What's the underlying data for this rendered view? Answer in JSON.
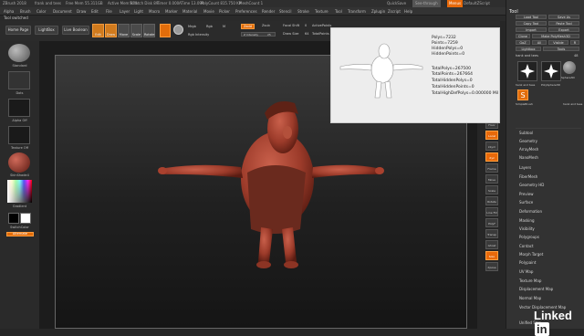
{
  "titlebar": {
    "app": "ZBrush 2018",
    "doc": "frank and tees",
    "free_mem": "Free Mem 55.311GB",
    "active_mem": "Active Mem 979",
    "scratch_disk": "Scratch Disk 89",
    "timer": "Timer 0.000",
    "atime": "ATime 13.099",
    "polycount": "PolyCount 815.750 KP",
    "mesh_count": "MeshCount 1",
    "quicksave": "QuickSave",
    "see_through": "See-through",
    "menus": "Menus",
    "default_zscript": "DefaultZScript"
  },
  "menubar": {
    "items": [
      "Alpha",
      "Brush",
      "Color",
      "Document",
      "Draw",
      "Edit",
      "File",
      "Layer",
      "Light",
      "Macro",
      "Marker",
      "Material",
      "Movie",
      "Picker",
      "Preferences",
      "Render",
      "Stencil",
      "Stroke",
      "Texture",
      "Tool",
      "Transform",
      "Zplugin",
      "Zscript",
      "Help"
    ]
  },
  "tabstrip": {
    "label": "Tool switched"
  },
  "topshelf": {
    "home_page": "Home Page",
    "lightbox": "LightBox",
    "live_boolean": "Live Boolean",
    "tools": [
      {
        "label": "Edit",
        "active": true
      },
      {
        "label": "Draw",
        "active": true
      },
      {
        "label": "Move",
        "active": false
      },
      {
        "label": "Scale",
        "active": false
      },
      {
        "label": "Rotate",
        "active": false
      }
    ],
    "mrgb": "Mrgb",
    "rgb": "Rgb",
    "m": "M",
    "rgb_intensity": "Rgb Intensity",
    "zadd": "Zadd",
    "zsub": "Zsub",
    "z_intensity": "Z Intensity",
    "z_intensity_value": "25",
    "focal_shift": "Focal Shift",
    "focal_value": "0",
    "draw_size": "Draw Size",
    "draw_size_value": "64",
    "dynamic": "Dynamic",
    "active_points": "ActivePoints",
    "total_points": "TotalPoints"
  },
  "leftshelf": {
    "items": [
      "Standard",
      "Dots",
      "Alpha Off",
      "Texture Off",
      "SkinShade4",
      "Gradient",
      "SwitchColor",
      "Alternate"
    ]
  },
  "rightshelf": {
    "items": [
      "BPR",
      "SPix",
      "Scroll",
      "Zoom",
      "Actual",
      "AAHalf",
      "Persp",
      "Floor",
      "Local",
      "LSym",
      "Xyz",
      "Frame",
      "Move",
      "Scale",
      "Rotate",
      "Line Fill",
      "PolyF",
      "Transp",
      "Ghost",
      "Solo",
      "Xpose"
    ]
  },
  "popup": {
    "polys": "Polys=7232",
    "points": "Points=7259",
    "hidden_polys": "HiddenPolys=0",
    "hidden_points": "HiddenPoints=0",
    "total_polys": "TotalPolys=267500",
    "total_points": "TotalPoints=267664",
    "total_hidden_polys": "TotalHiddenPolys=0",
    "total_hidden_points": "TotalHiddenPoints=0",
    "total_high_def": "TotalHighDefPolys=0.000000 Mil"
  },
  "toolpanel": {
    "title": "Tool",
    "buttons": [
      "Load Tool",
      "Save As",
      "Copy Tool",
      "Paste Tool",
      "Import",
      "Export",
      "Clone",
      "Make PolyMesh3D",
      "GoZ",
      "All",
      "Visible",
      "R",
      "Lightbox",
      "Tools"
    ],
    "current_tool": "hank and tees",
    "tool_value": "48",
    "thumbs": [
      "hank and tees",
      "PolySphere3D",
      "SimpleBrush",
      "Sphere3D",
      "hank and tees"
    ],
    "subpalettes": [
      "Subtool",
      "Geometry",
      "ArrayMesh",
      "NanoMesh",
      "Layers",
      "FiberMesh",
      "Geometry HD",
      "Preview",
      "Surface",
      "Deformation",
      "Masking",
      "Visibility",
      "Polygroups",
      "Contact",
      "Morph Target",
      "Polypaint",
      "UV Map",
      "Texture Map",
      "Displacement Map",
      "Normal Map",
      "Vector Displacement Map",
      "Unified Skin"
    ]
  },
  "branding": {
    "linked": "Linked",
    "in": "in"
  },
  "colors": {
    "accent_orange": "#e8690a",
    "model_red": "#9c3b2a"
  }
}
